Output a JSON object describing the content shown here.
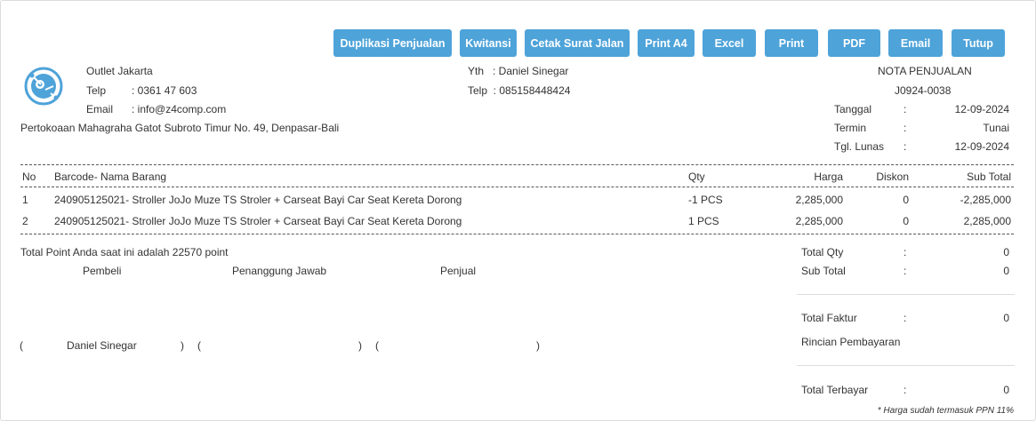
{
  "toolbar": {
    "buttons": [
      "Duplikasi Penjualan",
      "Kwitansi",
      "Cetak Surat Jalan",
      "Print A4",
      "Excel",
      "Print",
      "PDF",
      "Email",
      "Tutup"
    ]
  },
  "outlet": {
    "name": "Outlet Jakarta",
    "telp_label": "Telp",
    "telp_value": ": 0361 47 603",
    "email_label": "Email",
    "email_value": ": info@z4comp.com",
    "address": "Pertokoaan Mahagraha Gatot Subroto Timur No. 49, Denpasar-Bali"
  },
  "customer": {
    "yth": "Yth   : Daniel Sinegar",
    "telp": "Telp  : 085158448424"
  },
  "nota": {
    "title": "NOTA PENJUALAN",
    "number": "J0924-0038",
    "rows": [
      {
        "label": "Tanggal",
        "sep": ":",
        "value": "12-09-2024"
      },
      {
        "label": "Termin",
        "sep": ":",
        "value": "Tunai"
      },
      {
        "label": "Tgl. Lunas",
        "sep": ":",
        "value": "12-09-2024"
      }
    ]
  },
  "table": {
    "headers": {
      "no": "No",
      "item": "Barcode- Nama Barang",
      "qty": "Qty",
      "harga": "Harga",
      "diskon": "Diskon",
      "subtotal": "Sub Total"
    },
    "rows": [
      {
        "no": "1",
        "item": "240905125021- Stroller JoJo Muze TS Stroler + Carseat Bayi Car Seat Kereta Dorong",
        "qty": "-1 PCS",
        "harga": "2,285,000",
        "diskon": "0",
        "subtotal": "-2,285,000"
      },
      {
        "no": "2",
        "item": "240905125021- Stroller JoJo Muze TS Stroler + Carseat Bayi Car Seat Kereta Dorong",
        "qty": "1 PCS",
        "harga": "2,285,000",
        "diskon": "0",
        "subtotal": "2,285,000"
      }
    ]
  },
  "footer": {
    "points": "Total Point Anda saat ini adalah 22570 point",
    "sign_pembeli": "Pembeli",
    "sign_pj": "Penanggung Jawab",
    "sign_penjual": "Penjual",
    "paren_open": "(",
    "paren_close": ")",
    "buyer_name": "Daniel Sinegar"
  },
  "totals": {
    "total_qty_label": "Total Qty",
    "total_qty": "0",
    "sub_total_label": "Sub Total",
    "sub_total": "0",
    "total_faktur_label": "Total Faktur",
    "total_faktur": "0",
    "rincian_label": "Rincian Pembayaran",
    "total_terbayar_label": "Total Terbayar",
    "total_terbayar": "0",
    "sep": ":",
    "ppn_note": "* Harga sudah termasuk PPN 11%"
  }
}
